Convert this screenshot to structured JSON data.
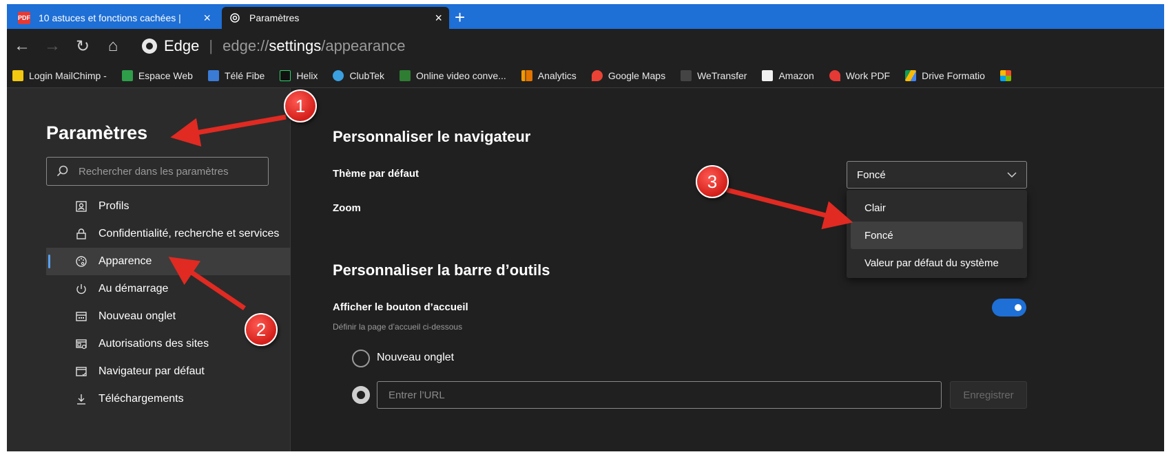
{
  "tabs": [
    {
      "title": "10 astuces et fonctions cachées |",
      "close": "×",
      "favicon": "PDF"
    },
    {
      "title": "Paramètres",
      "close": "×"
    }
  ],
  "new_tab": "+",
  "address": {
    "brand": "Edge",
    "separator": "|",
    "url_prefix": "edge://",
    "url_bold": "settings",
    "url_suffix": "/appearance"
  },
  "bookmarks": [
    {
      "label": "Login  MailChimp -",
      "color": "#f2c811"
    },
    {
      "label": "Espace Web",
      "color": "#2e9e4a"
    },
    {
      "label": "Télé Fibe",
      "color": "#3a7bd5"
    },
    {
      "label": "Helix",
      "color": "#1a1a1a"
    },
    {
      "label": "ClubTek",
      "color": "#3aa0e0"
    },
    {
      "label": "Online video conve...",
      "color": "#2f7d32"
    },
    {
      "label": "Analytics",
      "color": "#f29900"
    },
    {
      "label": "Google Maps",
      "color": "#ea4335"
    },
    {
      "label": "WeTransfer",
      "color": "#444444"
    },
    {
      "label": "Amazon",
      "color": "#f0f0f0"
    },
    {
      "label": "Work PDF",
      "color": "#e53935"
    },
    {
      "label": "Drive Formatio",
      "color": "#fbbc05"
    }
  ],
  "sidebar": {
    "title": "Paramètres",
    "search_placeholder": "Rechercher dans les paramètres",
    "items": [
      {
        "label": "Profils"
      },
      {
        "label": "Confidentialité, recherche et services"
      },
      {
        "label": "Apparence"
      },
      {
        "label": "Au démarrage"
      },
      {
        "label": "Nouveau onglet"
      },
      {
        "label": "Autorisations des sites"
      },
      {
        "label": "Navigateur par défaut"
      },
      {
        "label": "Téléchargements"
      }
    ]
  },
  "main": {
    "section1_title": "Personnaliser le navigateur",
    "theme_label": "Thème par défaut",
    "theme_value": "Foncé",
    "theme_options": [
      "Clair",
      "Foncé",
      "Valeur par défaut du système"
    ],
    "zoom_label": "Zoom",
    "section2_title": "Personnaliser la barre d’outils",
    "home_button_label": "Afficher le bouton d’accueil",
    "home_button_desc": "Définir la page d’accueil ci-dessous",
    "home_button_on": true,
    "radio_newtab": "Nouveau onglet",
    "url_placeholder": "Entrer l’URL",
    "save_label": "Enregistrer"
  },
  "annotations": {
    "badge1": "1",
    "badge2": "2",
    "badge3": "3"
  }
}
